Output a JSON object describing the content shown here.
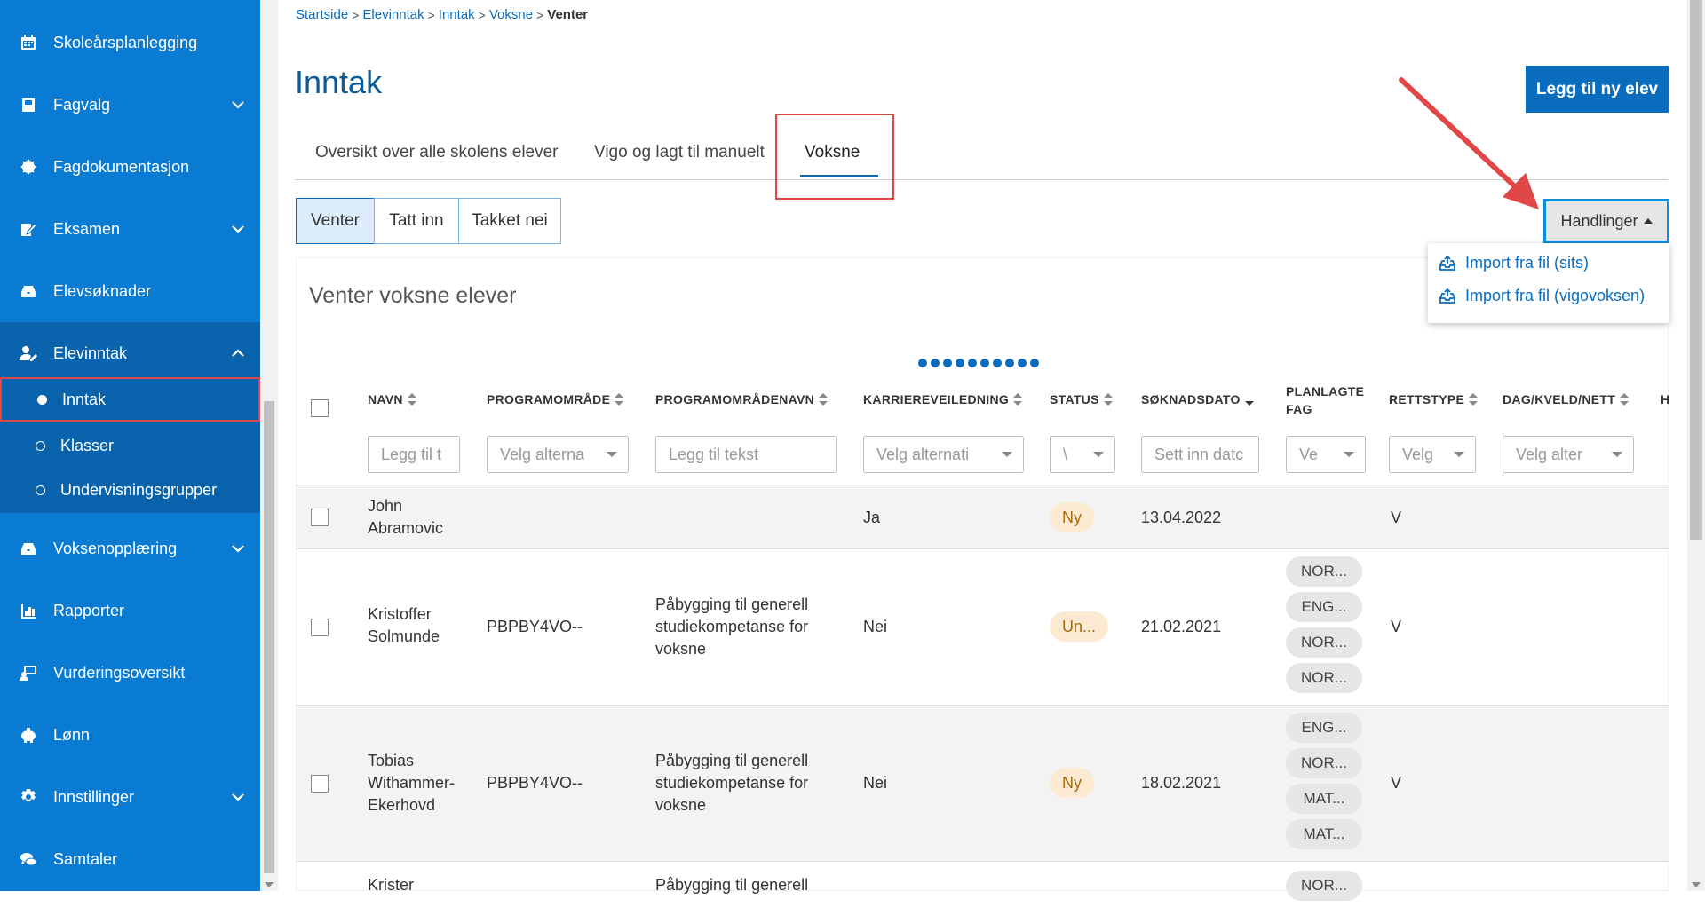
{
  "sidebar": {
    "items": [
      {
        "label": "Skoleårsplanlegging",
        "icon": "calendar-icon"
      },
      {
        "label": "Fagvalg",
        "icon": "book-icon"
      },
      {
        "label": "Fagdokumentasjon",
        "icon": "gear-badge-icon"
      },
      {
        "label": "Eksamen",
        "icon": "edit-icon"
      },
      {
        "label": "Elevsøknader",
        "icon": "inbox-icon"
      },
      {
        "label": "Elevinntak",
        "icon": "user-edit-icon"
      },
      {
        "label": "Voksenopplæring",
        "icon": "inbox-icon"
      },
      {
        "label": "Rapporter",
        "icon": "bar-chart-icon"
      },
      {
        "label": "Vurderingsoversikt",
        "icon": "presentation-icon"
      },
      {
        "label": "Lønn",
        "icon": "piggy-bank-icon"
      },
      {
        "label": "Innstillinger",
        "icon": "gear-icon"
      },
      {
        "label": "Samtaler",
        "icon": "chat-icon"
      }
    ],
    "subitems": [
      {
        "label": "Inntak"
      },
      {
        "label": "Klasser"
      },
      {
        "label": "Undervisningsgrupper"
      }
    ]
  },
  "breadcrumb": [
    "Startside",
    "Elevinntak",
    "Inntak",
    "Voksne",
    "Venter"
  ],
  "page_title": "Inntak",
  "add_button": "Legg til ny elev",
  "tabs": [
    "Oversikt over alle skolens elever",
    "Vigo og lagt til manuelt",
    "Voksne"
  ],
  "status_filter": [
    "Venter",
    "Tatt inn",
    "Takket nei"
  ],
  "actions": {
    "label": "Handlinger",
    "menu": [
      "Import fra fil (sits)",
      "Import fra fil (vigovoksen)"
    ]
  },
  "card_title": "Venter voksne elever",
  "columns": [
    "NAVN",
    "PROGRAMOMRÅDE",
    "PROGRAMOMRÅDENAVN",
    "KARRIEREVEILEDNING",
    "STATUS",
    "SØKNADSDATO",
    "PLANLAGTE FAG",
    "RETTSTYPE",
    "DAG/KVELD/NETT",
    "H"
  ],
  "filters": {
    "navn": "Legg til t",
    "programomrade": "Velg alterna",
    "programomradenavn": "Legg til tekst",
    "karriere": "Velg alternati",
    "status": "\\",
    "dato": "Sett inn datc",
    "fag": "Ve",
    "rettstype": "Velg",
    "dagkveld": "Velg alter"
  },
  "rows": [
    {
      "navn": "John Abramovic",
      "program": "",
      "programnavn": "",
      "karriere": "Ja",
      "status": "Ny",
      "dato": "13.04.2022",
      "fag": [],
      "rettstype": "V"
    },
    {
      "navn": "Kristoffer Solmunde",
      "program": "PBPBY4VO--",
      "programnavn": "Påbygging til generell studiekompetanse for voksne",
      "karriere": "Nei",
      "status": "Un...",
      "dato": "21.02.2021",
      "fag": [
        "NOR...",
        "ENG...",
        "NOR...",
        "NOR..."
      ],
      "rettstype": "V"
    },
    {
      "navn": "Tobias Withammer-Ekerhovd",
      "program": "PBPBY4VO--",
      "programnavn": "Påbygging til generell studiekompetanse for voksne",
      "karriere": "Nei",
      "status": "Ny",
      "dato": "18.02.2021",
      "fag": [
        "ENG...",
        "NOR...",
        "MAT...",
        "MAT..."
      ],
      "rettstype": "V"
    },
    {
      "navn": "Krister",
      "programnavn": "Påbygging til generell",
      "fag": [
        "NOR..."
      ]
    }
  ]
}
